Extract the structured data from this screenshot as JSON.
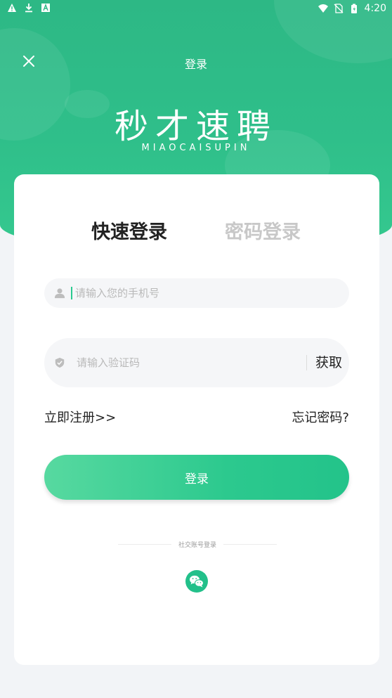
{
  "status_bar": {
    "time": "4:20",
    "icons_left": [
      "warning-icon",
      "download-icon",
      "app-a-icon"
    ],
    "icons_right": [
      "wifi-icon",
      "no-sim-icon",
      "battery-icon"
    ]
  },
  "header": {
    "title": "登录",
    "brand": "秒才速聘",
    "brand_sub": "MIAOCAISUPIN"
  },
  "tabs": [
    {
      "label": "快速登录",
      "active": true
    },
    {
      "label": "密码登录",
      "active": false
    }
  ],
  "phone_field": {
    "placeholder": "请输入您的手机号",
    "value": ""
  },
  "code_field": {
    "placeholder": "请输入验证码",
    "value": "",
    "action_label": "获取"
  },
  "links": {
    "register": "立即注册>>",
    "forgot": "忘记密码?"
  },
  "login_button": "登录",
  "social": {
    "label": "社交账号登录",
    "providers": [
      "wechat-icon"
    ]
  },
  "colors": {
    "brand_green": "#2db885",
    "button_green": "#2cc98e"
  }
}
